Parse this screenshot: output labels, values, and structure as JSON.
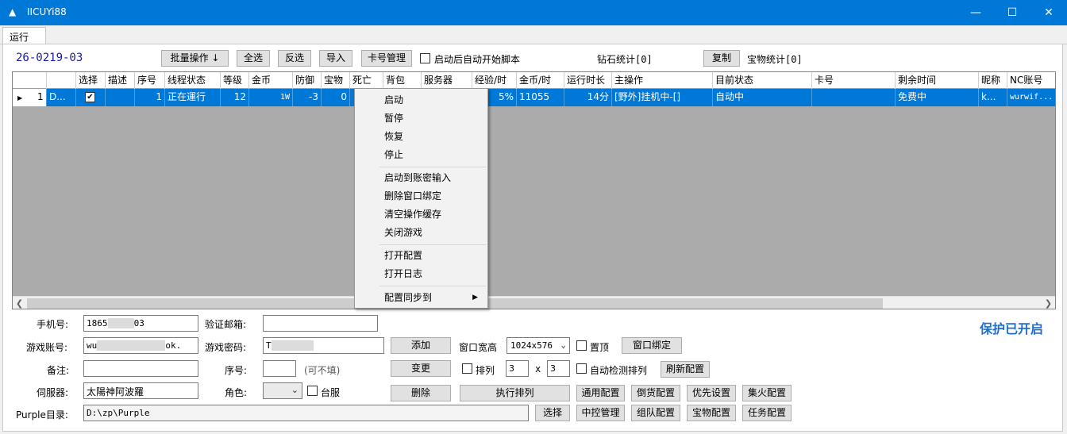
{
  "window": {
    "title": "IICUYi88",
    "tab": "运行",
    "accent": "#0078d7",
    "controls": [
      "minimize-icon",
      "maximize-icon",
      "close-icon"
    ]
  },
  "toolbar": {
    "code": "26-0219-03",
    "batch_ops": "批量操作 ↓",
    "select_all": "全选",
    "invert": "反选",
    "import": "导入",
    "card_mgmt": "卡号管理",
    "autostart_label": "启动后自动开始脚本",
    "diamond_stats": "钻石统计[0]",
    "copy": "复制",
    "treasure_stats": "宝物统计[0]"
  },
  "grid": {
    "columns": [
      "",
      "选择",
      "描述",
      "序号",
      "线程状态",
      "等级",
      "金币",
      "防御",
      "宝物",
      "死亡",
      "背包",
      "服务器",
      "经验/时",
      "金币/时",
      "运行时长",
      "主操作",
      "目前状态",
      "卡号",
      "剩余时间",
      "昵称",
      "NC账号"
    ],
    "rows": [
      {
        "num": "1",
        "c0": "D...",
        "select": true,
        "desc": "",
        "seq": "1",
        "thread": "正在運行",
        "level": "12",
        "gold": "1W",
        "defense": "-3",
        "treasure": "0",
        "death": "",
        "bag": "",
        "server": "",
        "exp": "5%",
        "gold_h": "11055",
        "runtime": "14分",
        "main_op": "[野外]挂机中-[]",
        "status": "自动中",
        "card": "",
        "remain": "免费中",
        "nick": "k...",
        "nc": "wurwif..."
      }
    ]
  },
  "context_menu": {
    "items": [
      "启动",
      "暂停",
      "恢复",
      "停止",
      "启动到账密输入",
      "删除窗口绑定",
      "清空操作缓存",
      "关闭游戏",
      "打开配置",
      "打开日志",
      "配置同步到"
    ]
  },
  "form": {
    "phone_label": "手机号:",
    "phone_value_a": "1865",
    "phone_value_b": "03",
    "email_label": "验证邮箱:",
    "email_value": "",
    "account_label": "游戏账号:",
    "account_value_a": "wu",
    "account_value_b": "ok.",
    "password_label": "游戏密码:",
    "password_value": "T",
    "note_label": "备注:",
    "note_value": "",
    "seq_label": "序号:",
    "seq_value": "",
    "seq_hint": "(可不填)",
    "server_label": "伺服器:",
    "server_value": "太陽神阿波羅",
    "role_label": "角色:",
    "role_value": "",
    "taiwan_label": "台服",
    "dir_label": "Purple目录:",
    "dir_value": "D:\\zp\\Purple",
    "add": "添加",
    "change": "变更",
    "delete": "删除",
    "win_size_label": "窗口宽高",
    "win_size_value": "1024x576",
    "topmost_label": "置顶",
    "bind_window": "窗口绑定",
    "arrange_label": "排列",
    "arrange_x": "3",
    "times": "x",
    "arrange_y": "3",
    "auto_detect_label": "自动检测排列",
    "refresh_config": "刷新配置",
    "exec_arrange": "执行排列",
    "select": "选择",
    "general_config": "通用配置",
    "sell_config": "倒货配置",
    "priority": "优先设置",
    "gather_config": "集火配置",
    "central_mgmt": "中控管理",
    "team_config": "组队配置",
    "treasure_config": "宝物配置",
    "task_config": "任务配置",
    "protect_status": "保护已开启"
  }
}
